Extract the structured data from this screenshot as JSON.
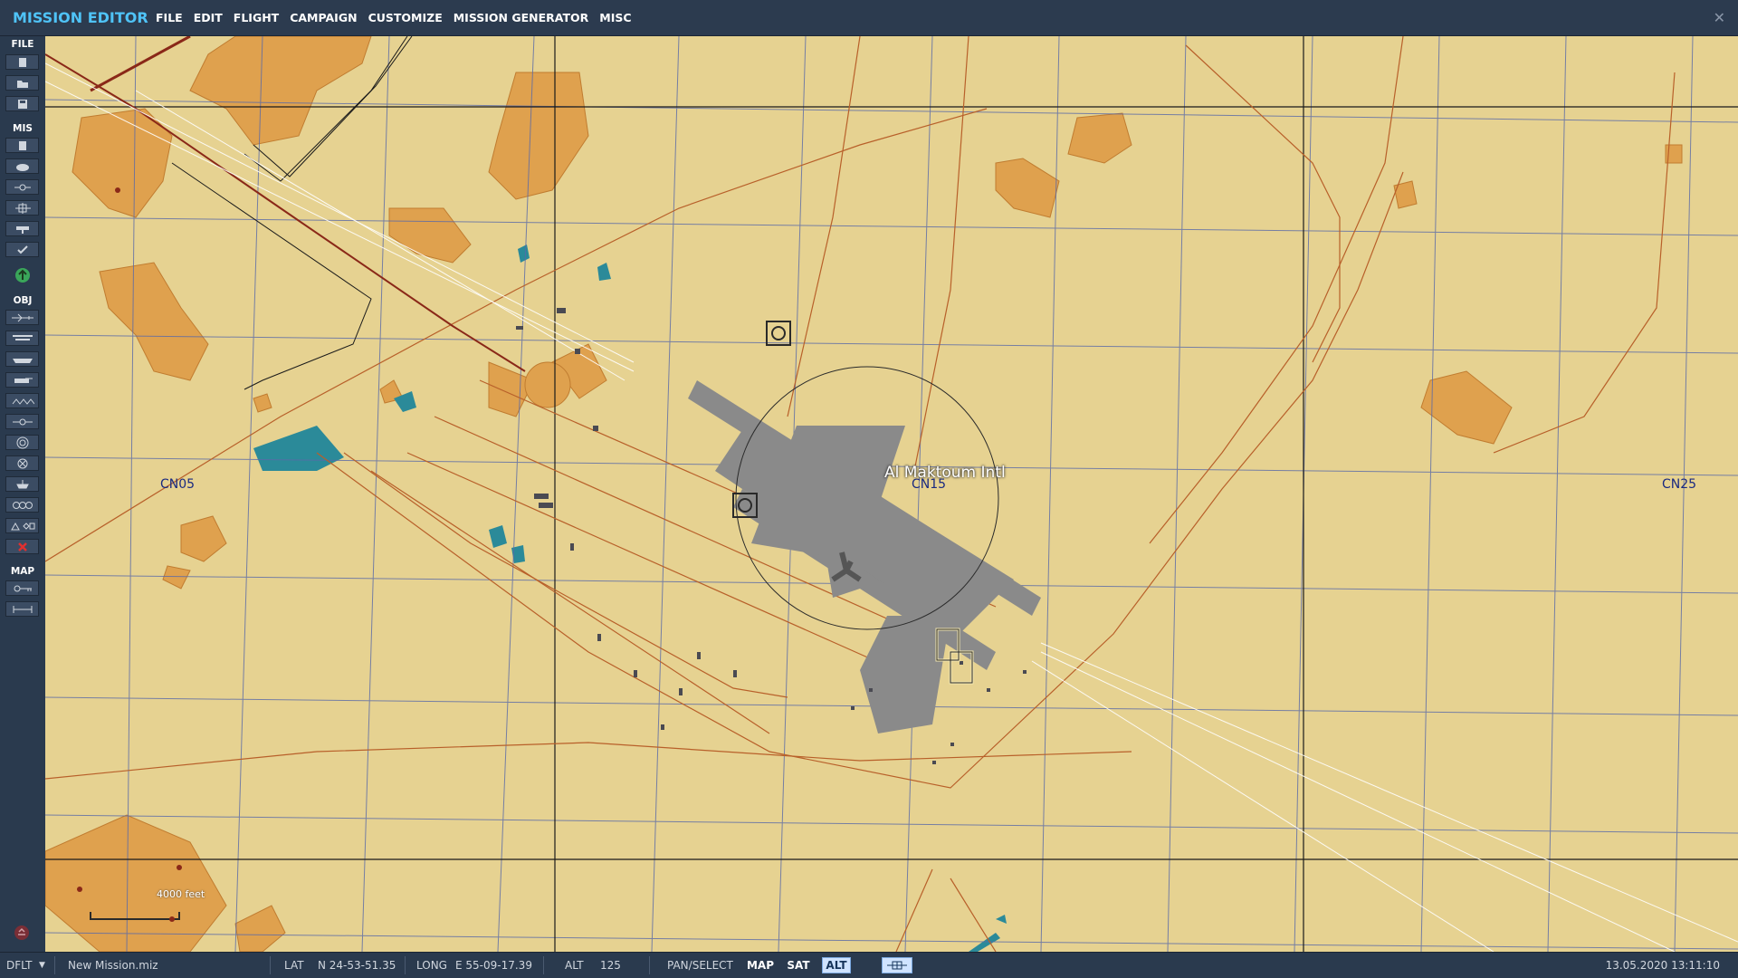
{
  "app": {
    "title": "MISSION EDITOR",
    "menu": [
      "FILE",
      "EDIT",
      "FLIGHT",
      "CAMPAIGN",
      "CUSTOMIZE",
      "MISSION GENERATOR",
      "MISC"
    ],
    "close_icon": "close-icon"
  },
  "toolbar": {
    "file_label": "FILE",
    "mis_label": "MIS",
    "obj_label": "OBJ",
    "map_label": "MAP",
    "file_buttons": [
      "new-file-icon",
      "open-file-icon",
      "save-file-icon"
    ],
    "mis_buttons": [
      "briefing-icon",
      "weather-icon",
      "trigger-zone-icon",
      "trigger-icon",
      "goals-icon",
      "check-icon"
    ],
    "obj_buttons": [
      "add-plane-icon",
      "add-helicopter-icon",
      "add-ship-icon",
      "add-ground-unit-icon",
      "add-static-icon",
      "add-waypoint-icon",
      "add-zone-icon",
      "add-target-icon",
      "add-ndb-icon",
      "add-group-icon",
      "draw-shapes-icon",
      "delete-icon"
    ],
    "map_buttons": [
      "map-key-icon",
      "ruler-icon"
    ],
    "active_indicator": "green-up-arrow-icon",
    "bottom_icon": "eject-icon"
  },
  "map": {
    "airport_name": "Al Maktoum Intl",
    "grid_labels": [
      "CN05",
      "CN15",
      "CN25"
    ],
    "scale_label": "4000 feet",
    "colors": {
      "terrain": "#e6d291",
      "town": "#dfa14e",
      "water": "#2b8a99",
      "road": "#b8602a",
      "runway": "#8a8a8a",
      "grid_line": "#5a6aa8"
    }
  },
  "statusbar": {
    "profile": "DFLT",
    "mission_file": "New Mission.miz",
    "lat_label": "LAT",
    "lat_value": "N 24-53-51.35",
    "long_label": "LONG",
    "long_value": "E 55-09-17.39",
    "alt_label": "ALT",
    "alt_value": "125",
    "pan_select": "PAN/SELECT",
    "map_btn": "MAP",
    "sat_btn": "SAT",
    "alt_btn": "ALT",
    "datetime": "13.05.2020 13:11:10"
  }
}
